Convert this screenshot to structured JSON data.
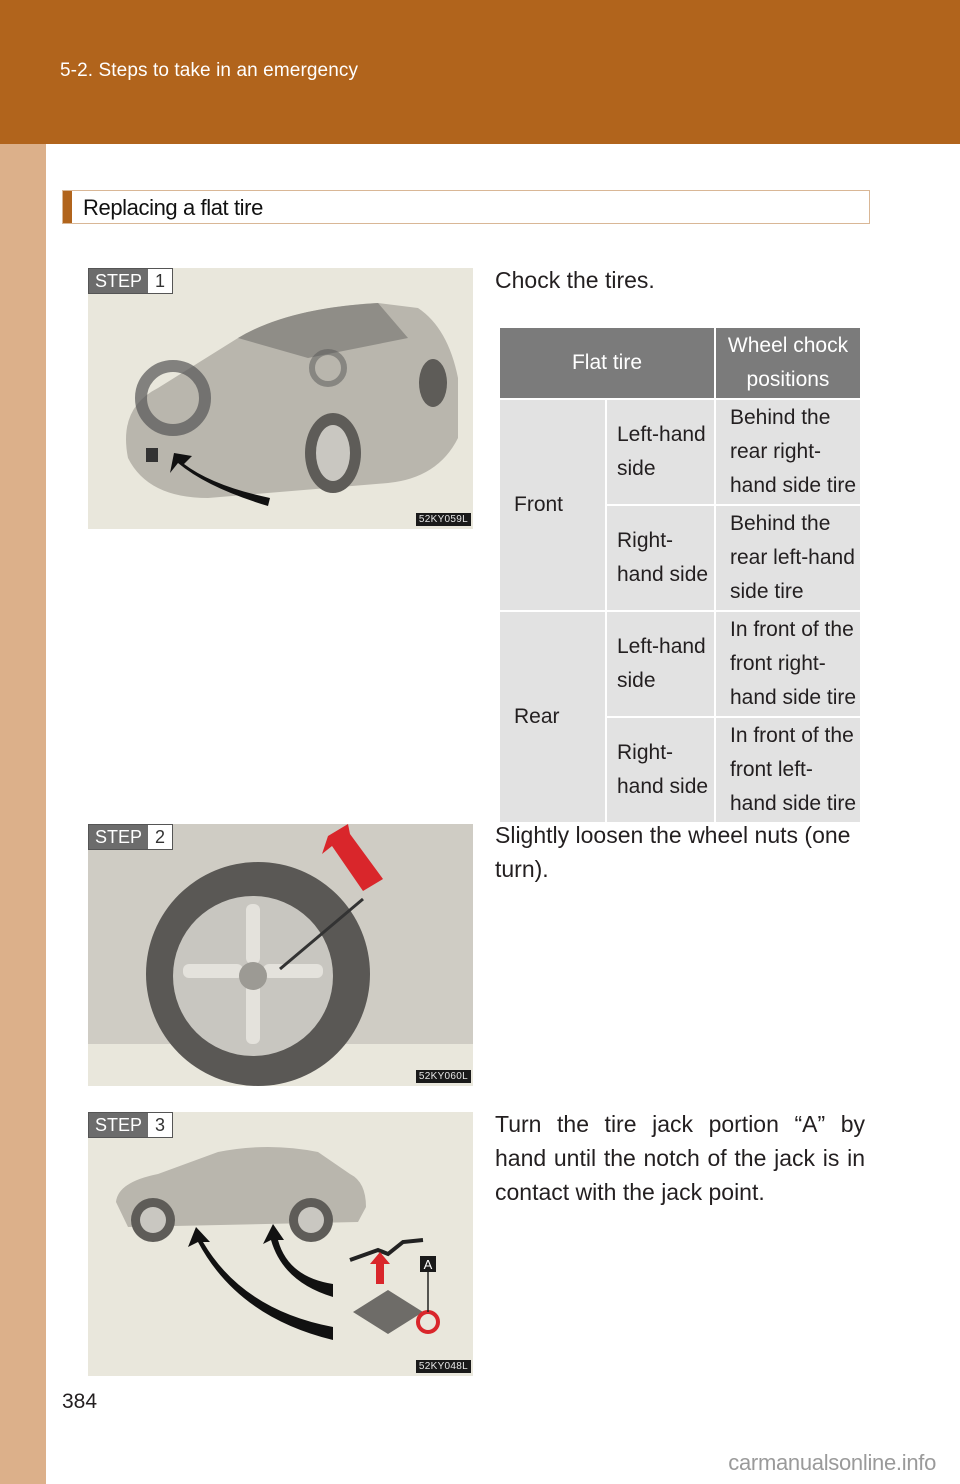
{
  "header": {
    "chapter": "5-2. Steps to take in an emergency"
  },
  "section": {
    "title": "Replacing a flat tire"
  },
  "steps": [
    {
      "label": "STEP",
      "number": "1",
      "figure_code": "52KY059L",
      "text": "Chock the tires."
    },
    {
      "label": "STEP",
      "number": "2",
      "figure_code": "52KY060L",
      "text": "Slightly loosen the wheel nuts (one turn)."
    },
    {
      "label": "STEP",
      "number": "3",
      "figure_code": "52KY048L",
      "text": "Turn the tire jack portion “A” by hand until the notch of the jack is in contact with the jack point.",
      "callout": "A"
    }
  ],
  "chock_table": {
    "headers": [
      "Flat tire",
      "Wheel chock positions"
    ],
    "rows": [
      {
        "group": "Front",
        "side": "Left-hand side",
        "position": "Behind the rear right-hand side tire"
      },
      {
        "group": "Front",
        "side": "Right-hand side",
        "position": "Behind the rear left-hand side tire"
      },
      {
        "group": "Rear",
        "side": "Left-hand side",
        "position": "In front of the front right-hand side tire"
      },
      {
        "group": "Rear",
        "side": "Right-hand side",
        "position": "In front of the front left-hand side tire"
      }
    ]
  },
  "footer": {
    "page_number": "384",
    "watermark": "carmanualsonline.info"
  },
  "colors": {
    "brand": "#b1641c",
    "side_strip": "#dcb08a",
    "table_header": "#7b7b7b",
    "table_cell": "#e2e2e2",
    "figure_bg": "#e9e7dc",
    "arrow_red": "#d9262b"
  }
}
